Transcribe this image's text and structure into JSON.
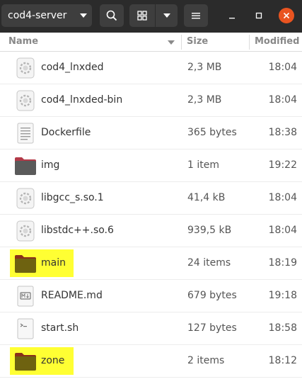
{
  "window": {
    "path_label": "cod4-server"
  },
  "header": {
    "search_icon": "search-icon",
    "view_icon": "grid-view-icon",
    "menu_icon": "hamburger-menu-icon"
  },
  "columns": {
    "name": "Name",
    "size": "Size",
    "modified": "Modified"
  },
  "files": [
    {
      "name": "cod4_lnxded",
      "size": "2,3 MB",
      "modified": "18:04",
      "icon": "executable-icon"
    },
    {
      "name": "cod4_lnxded-bin",
      "size": "2,3 MB",
      "modified": "18:04",
      "icon": "executable-icon"
    },
    {
      "name": "Dockerfile",
      "size": "365 bytes",
      "modified": "18:38",
      "icon": "text-file-icon"
    },
    {
      "name": "img",
      "size": "1 item",
      "modified": "19:22",
      "icon": "folder-icon"
    },
    {
      "name": "libgcc_s.so.1",
      "size": "41,4 kB",
      "modified": "18:04",
      "icon": "library-icon"
    },
    {
      "name": "libstdc++.so.6",
      "size": "939,5 kB",
      "modified": "18:04",
      "icon": "library-icon"
    },
    {
      "name": "main",
      "size": "24 items",
      "modified": "18:19",
      "icon": "folder-icon",
      "highlighted": true
    },
    {
      "name": "README.md",
      "size": "679 bytes",
      "modified": "19:18",
      "icon": "markdown-file-icon"
    },
    {
      "name": "start.sh",
      "size": "127 bytes",
      "modified": "18:58",
      "icon": "script-file-icon"
    },
    {
      "name": "zone",
      "size": "2 items",
      "modified": "18:12",
      "icon": "folder-icon",
      "highlighted": true
    }
  ],
  "colors": {
    "header_bg": "#2b2b2b",
    "close_button": "#e95420",
    "highlight": "#ffff33",
    "folder_plain": "#5a5a5a",
    "folder_highlighted": "#6e6210"
  }
}
